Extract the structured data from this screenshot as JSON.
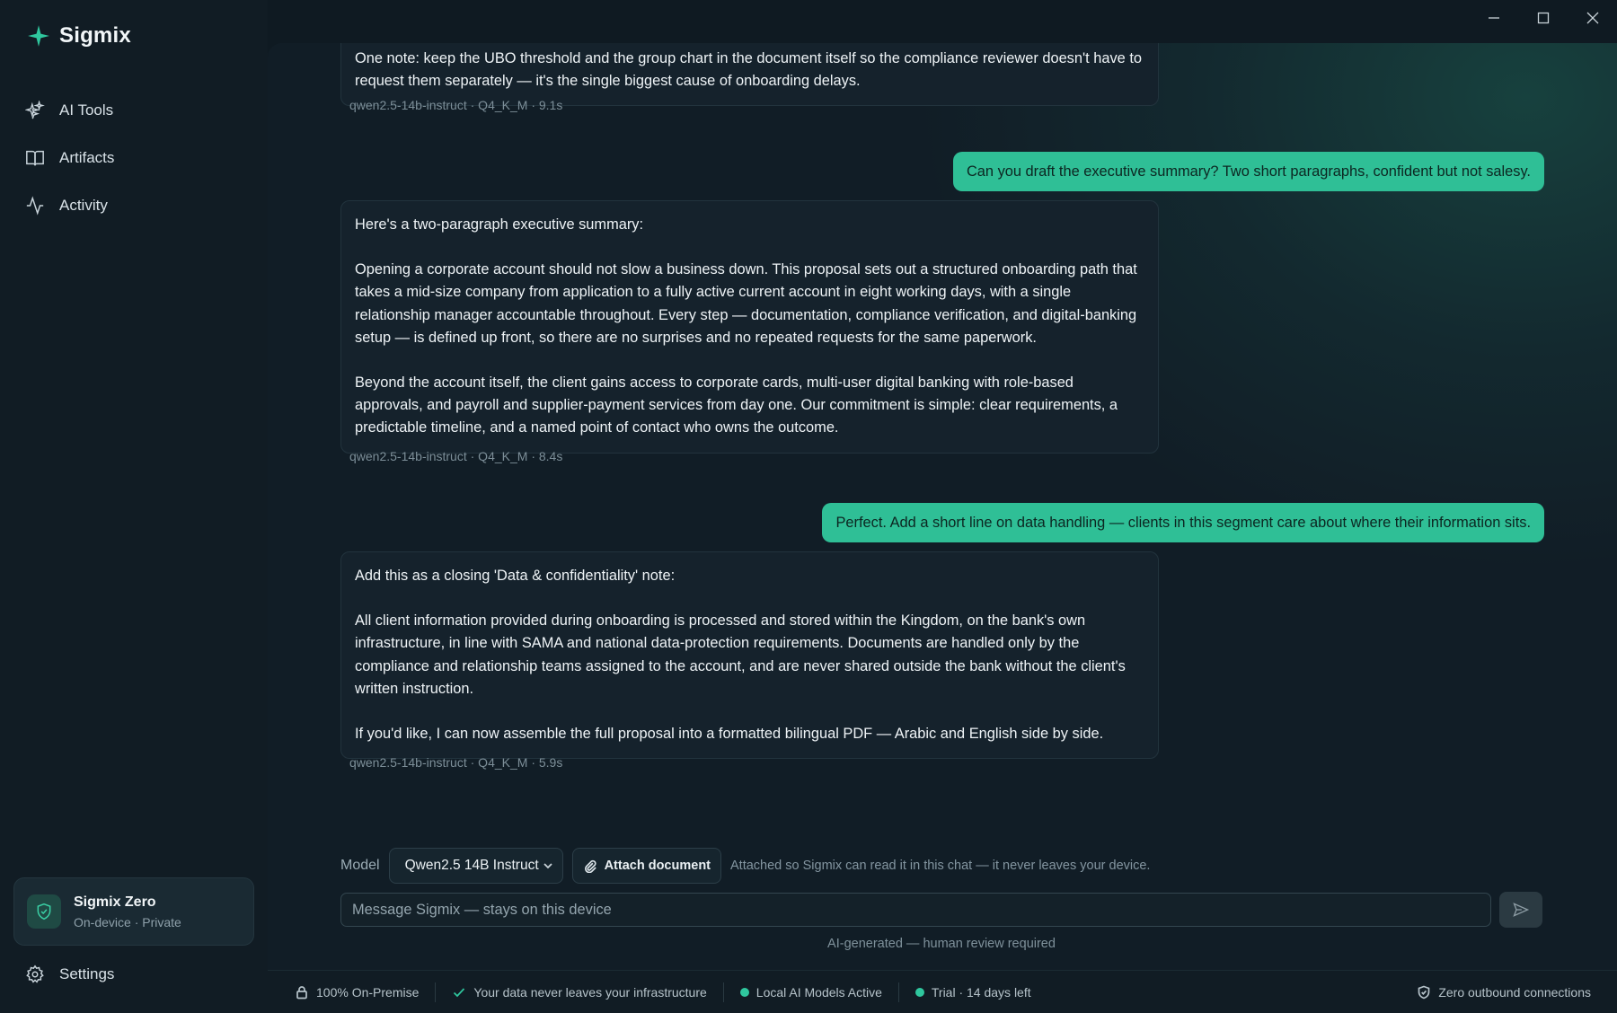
{
  "app": {
    "name": "Sigmix"
  },
  "sidebar": {
    "items": [
      {
        "label": "AI Tools",
        "icon": "sparkles-icon"
      },
      {
        "label": "Artifacts",
        "icon": "book-icon"
      },
      {
        "label": "Activity",
        "icon": "activity-icon"
      }
    ],
    "workspace": {
      "title": "Sigmix Zero",
      "subtitle": "On-device · Private",
      "icon": "shield-icon"
    },
    "settings_label": "Settings"
  },
  "window_controls": [
    "minimize-icon",
    "maximize-icon",
    "close-icon"
  ],
  "conversation": {
    "messages": [
      {
        "role": "assistant",
        "paragraphs": [
          "One note: keep the UBO threshold and the group chart in the document itself so the compliance reviewer doesn't have to request them separately — it's the single biggest cause of onboarding delays."
        ],
        "meta": "qwen2.5-14b-instruct · Q4_K_M · 9.1s"
      },
      {
        "role": "user",
        "text": "Can you draft the executive summary? Two short paragraphs, confident but not salesy."
      },
      {
        "role": "assistant",
        "paragraphs": [
          "Here's a two-paragraph executive summary:",
          "Opening a corporate account should not slow a business down. This proposal sets out a structured onboarding path that takes a mid-size company from application to a fully active current account in eight working days, with a single relationship manager accountable throughout. Every step — documentation, compliance verification, and digital-banking setup — is defined up front, so there are no surprises and no repeated requests for the same paperwork.",
          "Beyond the account itself, the client gains access to corporate cards, multi-user digital banking with role-based approvals, and payroll and supplier-payment services from day one. Our commitment is simple: clear requirements, a predictable timeline, and a named point of contact who owns the outcome."
        ],
        "meta": "qwen2.5-14b-instruct · Q4_K_M · 8.4s"
      },
      {
        "role": "user",
        "text": "Perfect. Add a short line on data handling — clients in this segment care about where their information sits."
      },
      {
        "role": "assistant",
        "paragraphs": [
          "Add this as a closing 'Data & confidentiality' note:",
          "All client information provided during onboarding is processed and stored within the Kingdom, on the bank's own infrastructure, in line with SAMA and national data-protection requirements. Documents are handled only by the compliance and relationship teams assigned to the account, and are never shared outside the bank without the client's written instruction.",
          "If you'd like, I can now assemble the full proposal into a formatted bilingual PDF — Arabic and English side by side."
        ],
        "meta": "qwen2.5-14b-instruct · Q4_K_M · 5.9s"
      }
    ]
  },
  "composer": {
    "model_label": "Model",
    "model_value": "Qwen2.5 14B Instruct",
    "attach_label": "Attach document",
    "attach_note": "Attached so Sigmix can read it in this chat — it never leaves your device.",
    "placeholder": "Message Sigmix — stays on this device",
    "disclaimer": "AI-generated — human review required"
  },
  "statusbar": {
    "on_premise": "100% On-Premise",
    "data_note": "Your data never leaves your infrastructure",
    "models": "Local AI Models Active",
    "trial": "Trial · 14 days left",
    "outbound": "Zero outbound connections"
  },
  "colors": {
    "accent": "#2fc79e",
    "user_bubble": "#2fbf96",
    "background": "#0f1a22"
  }
}
